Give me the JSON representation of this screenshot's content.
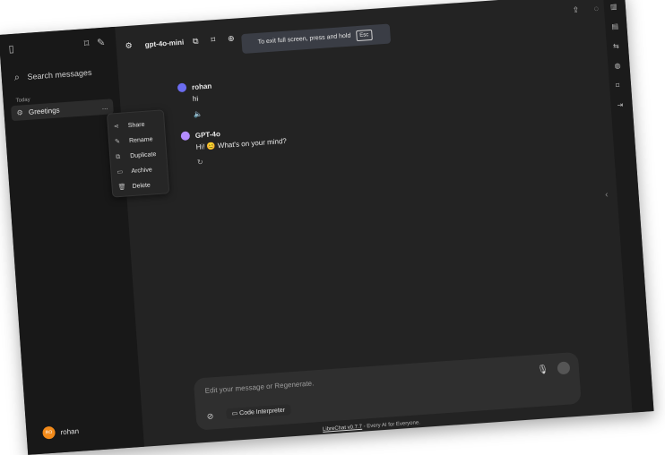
{
  "sidebar": {
    "search_placeholder": "Search messages",
    "section_label": "Today",
    "conversation_title": "Greetings",
    "more_label": "...",
    "user_initials": "RO",
    "user_name": "rohan"
  },
  "context_menu": {
    "items": [
      "Share",
      "Rename",
      "Duplicate",
      "Archive",
      "Delete"
    ]
  },
  "topbar": {
    "model_name": "gpt-4o-mini"
  },
  "banner": {
    "text": "To exit full screen, press and hold",
    "key": "Esc"
  },
  "chat": {
    "user_name": "rohan",
    "user_message": "hi",
    "assistant_name": "GPT-4o",
    "assistant_message": "Hi! 😊 What's on your mind?"
  },
  "composer": {
    "placeholder": "Edit your message or Regenerate.",
    "tool_label": "Code Interpreter"
  },
  "footer": {
    "link_text": "LibreChat v0.7.7",
    "tagline": " - Every AI for Everyone."
  },
  "colors": {
    "app_bg": "#232323",
    "sidebar_bg": "#181818",
    "user_avatar": "#6b6cf0",
    "assistant_avatar": "#b48cff",
    "profile_avatar": "#f28a1a"
  }
}
